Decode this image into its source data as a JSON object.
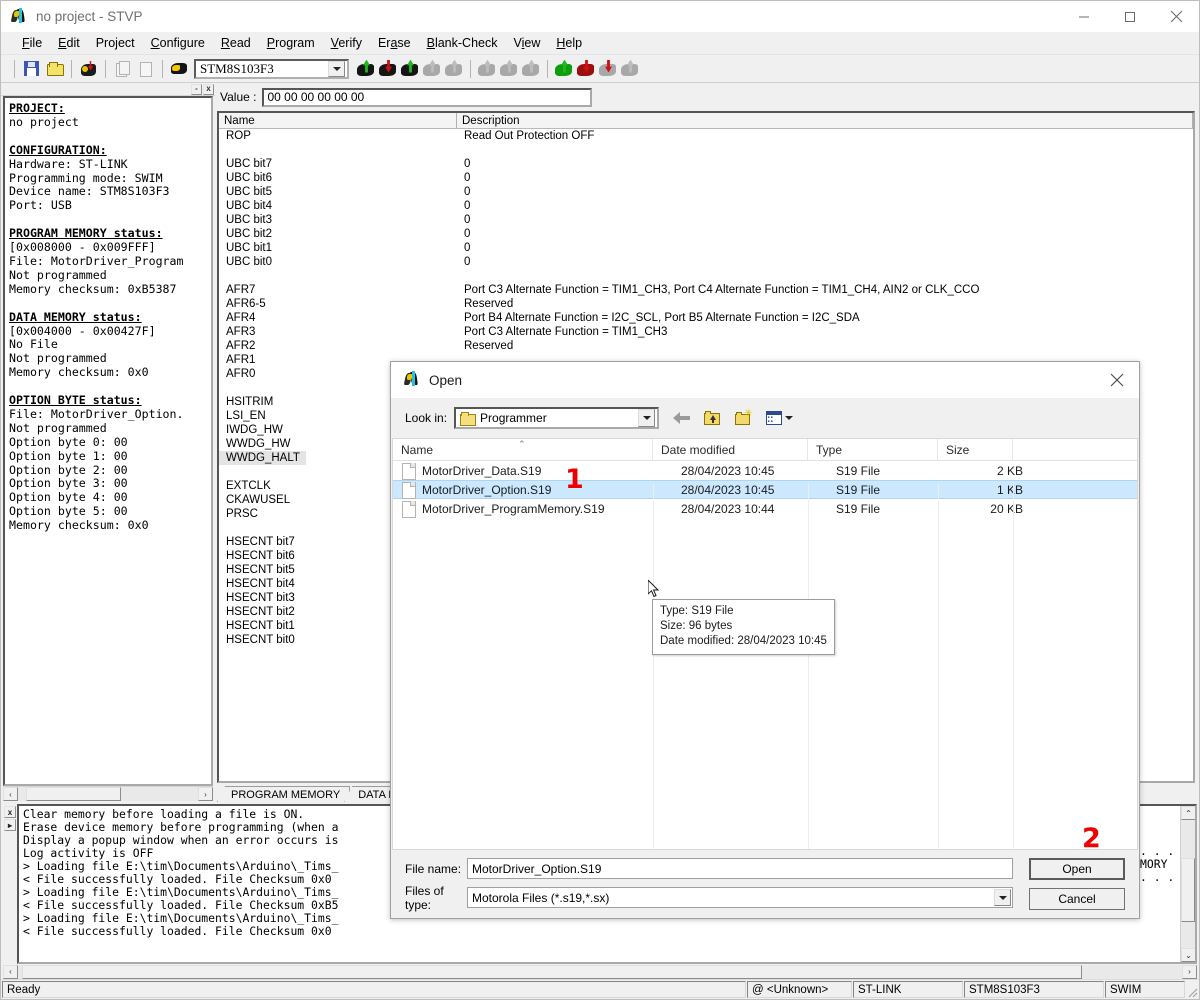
{
  "window": {
    "title": "no project - STVP",
    "icon": "stvp-moth-icon",
    "minimize": "minimize-icon",
    "maximize": "maximize-icon",
    "close": "close-icon"
  },
  "menu": {
    "items": [
      {
        "label": "File",
        "mnemonic": "F"
      },
      {
        "label": "Edit",
        "mnemonic": "E"
      },
      {
        "label": "Project",
        "mnemonic": "j"
      },
      {
        "label": "Configure",
        "mnemonic": "C"
      },
      {
        "label": "Read",
        "mnemonic": "R"
      },
      {
        "label": "Program",
        "mnemonic": "P"
      },
      {
        "label": "Verify",
        "mnemonic": "V"
      },
      {
        "label": "Erase",
        "mnemonic": "a"
      },
      {
        "label": "Blank-Check",
        "mnemonic": "B"
      },
      {
        "label": "View",
        "mnemonic": "i"
      },
      {
        "label": "Help",
        "mnemonic": "H"
      }
    ]
  },
  "toolbar": {
    "device_combo_value": "STM8S103F3",
    "buttons": [
      {
        "name": "save-icon"
      },
      {
        "name": "open-file-icon"
      },
      {
        "name": "erase-device-icon"
      },
      {
        "name": "copy-icon"
      },
      {
        "name": "paste-icon"
      },
      {
        "name": "device-select-icon"
      }
    ],
    "program_icons": [
      {
        "name": "read-tab1-icon",
        "body": "#151515",
        "arrow": "#1fb81f",
        "dir": "up",
        "enabled": true
      },
      {
        "name": "read-tab2-icon",
        "body": "#151515",
        "arrow": "#d01010",
        "dir": "down",
        "enabled": true
      },
      {
        "name": "read-tab3-icon",
        "body": "#151515",
        "arrow": "#1fb81f",
        "dir": "up",
        "enabled": true
      },
      {
        "name": "read-tab4-icon",
        "body": "#a8a8a8",
        "arrow": "#bdbdbd",
        "dir": "up",
        "enabled": false
      },
      {
        "name": "read-tab5-icon",
        "body": "#a8a8a8",
        "arrow": "#bdbdbd",
        "dir": "up",
        "enabled": false
      },
      {
        "name": "verify-tab1-icon",
        "body": "#a8a8a8",
        "arrow": "#bdbdbd",
        "dir": "up",
        "enabled": false
      },
      {
        "name": "verify-tab2-icon",
        "body": "#a8a8a8",
        "arrow": "#bdbdbd",
        "dir": "up",
        "enabled": false
      },
      {
        "name": "verify-tab3-icon",
        "body": "#a8a8a8",
        "arrow": "#bdbdbd",
        "dir": "up",
        "enabled": false
      },
      {
        "name": "program-tab1-icon",
        "body": "#0f9c0f",
        "arrow": "#1fb81f",
        "dir": "up",
        "enabled": true
      },
      {
        "name": "program-tab2-icon",
        "body": "#9c0f0f",
        "arrow": "#d01010",
        "dir": "down",
        "enabled": true
      },
      {
        "name": "program-tab3-icon",
        "body": "#a8a8a8",
        "arrow": "#d01010",
        "dir": "down",
        "enabled": true
      },
      {
        "name": "program-tab4-icon",
        "body": "#a8a8a8",
        "arrow": "#bdbdbd",
        "dir": "up",
        "enabled": false
      }
    ]
  },
  "project_panel": {
    "text": "PROJECT:|no project||CONFIGURATION:|Hardware: ST-LINK|Programming mode: SWIM|Device name: STM8S103F3|Port: USB||PROGRAM MEMORY status:|[0x008000 - 0x009FFF]|File: MotorDriver_Program|Not programmed|Memory checksum: 0xB5387||DATA MEMORY status:|[0x004000 - 0x00427F]|No File|Not programmed|Memory checksum: 0x0||OPTION BYTE status:|File: MotorDriver_Option.|Not programmed|Option byte 0: 00|Option byte 1: 00|Option byte 2: 00|Option byte 3: 00|Option byte 4: 00|Option byte 5: 00|Memory checksum: 0x0",
    "headings": [
      "PROJECT:",
      "CONFIGURATION:",
      "PROGRAM MEMORY status:",
      "DATA MEMORY status:",
      "OPTION BYTE status:"
    ],
    "close_button": "x",
    "minimize_button": "-"
  },
  "option_view": {
    "value_label": "Value :",
    "value_text": "00 00 00 00 00 00",
    "columns": [
      "Name",
      "Description"
    ],
    "rows": [
      {
        "name": "ROP",
        "desc": "Read Out Protection OFF"
      },
      {
        "name": "",
        "desc": ""
      },
      {
        "name": "UBC bit7",
        "desc": "0"
      },
      {
        "name": "UBC bit6",
        "desc": "0"
      },
      {
        "name": "UBC bit5",
        "desc": "0"
      },
      {
        "name": "UBC bit4",
        "desc": "0"
      },
      {
        "name": "UBC bit3",
        "desc": "0"
      },
      {
        "name": "UBC bit2",
        "desc": "0"
      },
      {
        "name": "UBC bit1",
        "desc": "0"
      },
      {
        "name": "UBC bit0",
        "desc": "0"
      },
      {
        "name": "",
        "desc": ""
      },
      {
        "name": "AFR7",
        "desc": "Port C3 Alternate Function = TIM1_CH3, Port C4 Alternate Function = TIM1_CH4, AIN2 or CLK_CCO"
      },
      {
        "name": "AFR6-5",
        "desc": "Reserved"
      },
      {
        "name": "AFR4",
        "desc": "Port B4 Alternate Function = I2C_SCL, Port B5 Alternate Function = I2C_SDA"
      },
      {
        "name": "AFR3",
        "desc": "Port C3 Alternate Function = TIM1_CH3"
      },
      {
        "name": "AFR2",
        "desc": "Reserved"
      },
      {
        "name": "AFR1",
        "desc": ""
      },
      {
        "name": "AFR0",
        "desc": ""
      },
      {
        "name": "",
        "desc": ""
      },
      {
        "name": "HSITRIM",
        "desc": ""
      },
      {
        "name": "LSI_EN",
        "desc": ""
      },
      {
        "name": "IWDG_HW",
        "desc": ""
      },
      {
        "name": "WWDG_HW",
        "desc": ""
      },
      {
        "name": "WWDG_HALT",
        "desc": "",
        "selected": true
      },
      {
        "name": "",
        "desc": ""
      },
      {
        "name": "EXTCLK",
        "desc": ""
      },
      {
        "name": "CKAWUSEL",
        "desc": ""
      },
      {
        "name": "PRSC",
        "desc": ""
      },
      {
        "name": "",
        "desc": ""
      },
      {
        "name": "HSECNT bit7",
        "desc": ""
      },
      {
        "name": "HSECNT bit6",
        "desc": ""
      },
      {
        "name": "HSECNT bit5",
        "desc": ""
      },
      {
        "name": "HSECNT bit4",
        "desc": ""
      },
      {
        "name": "HSECNT bit3",
        "desc": ""
      },
      {
        "name": "HSECNT bit2",
        "desc": ""
      },
      {
        "name": "HSECNT bit1",
        "desc": ""
      },
      {
        "name": "HSECNT bit0",
        "desc": ""
      }
    ],
    "tabs": [
      {
        "label": "PROGRAM MEMORY",
        "active": true
      },
      {
        "label": "DATA ME",
        "active": false
      }
    ]
  },
  "console": {
    "lines": [
      "Clear memory before loading a file is ON.",
      "Erase device memory before programming (when a",
      "Display a popup window when an error occurs is",
      "Log activity is OFF",
      "> Loading file E:\\tim\\Documents\\Arduino\\_Tims_",
      "< File successfully loaded. File Checksum 0x0",
      "> Loading file E:\\tim\\Documents\\Arduino\\_Tims_",
      "< File successfully loaded. File Checksum 0xB5",
      "> Loading file E:\\tim\\Documents\\Arduino\\_Tims_",
      "< File successfully loaded. File Checksum 0x0"
    ],
    "right_fragment_lines": [
      "",
      "",
      "",
      "",
      "...",
      "MORY",
      "",
      "..."
    ]
  },
  "statusbar": {
    "ready": "Ready",
    "target": "@ <Unknown>",
    "hardware": "ST-LINK",
    "device": "STM8S103F3",
    "mode": "SWIM"
  },
  "dialog": {
    "title": "Open",
    "icon": "stvp-moth-icon",
    "close": "close-icon",
    "look_in_label": "Look in:",
    "look_in_value": "Programmer",
    "toolbar": [
      {
        "name": "back-arrow-icon"
      },
      {
        "name": "up-one-level-icon"
      },
      {
        "name": "new-folder-icon"
      },
      {
        "name": "view-menu-icon"
      }
    ],
    "columns": [
      "Name",
      "Date modified",
      "Type",
      "Size"
    ],
    "files": [
      {
        "name": "MotorDriver_Data.S19",
        "date": "28/04/2023 10:45",
        "type": "S19 File",
        "size": "2 KB",
        "selected": false
      },
      {
        "name": "MotorDriver_Option.S19",
        "date": "28/04/2023 10:45",
        "type": "S19 File",
        "size": "1 KB",
        "selected": true
      },
      {
        "name": "MotorDriver_ProgramMemory.S19",
        "date": "28/04/2023 10:44",
        "type": "S19 File",
        "size": "20 KB",
        "selected": false
      }
    ],
    "tooltip": {
      "type": "Type: S19 File",
      "size": "Size: 96 bytes",
      "date": "Date modified: 28/04/2023 10:45"
    },
    "file_name_label": "File name:",
    "file_name_value": "MotorDriver_Option.S19",
    "files_of_type_label": "Files of type:",
    "files_of_type_value": "Motorola Files (*.s19,*.sx)",
    "open_button": "Open",
    "cancel_button": "Cancel"
  },
  "annotations": [
    {
      "label": "1",
      "color": "#ee0000"
    },
    {
      "label": "2",
      "color": "#ee0000"
    }
  ]
}
